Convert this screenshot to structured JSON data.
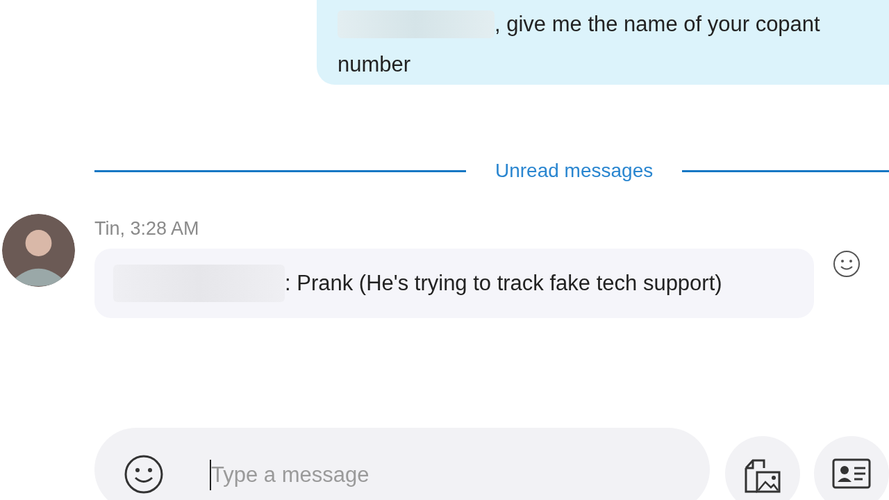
{
  "sent_message": {
    "lines": [
      ", give me the name of your copant",
      "number"
    ]
  },
  "divider": {
    "label": "Unread messages"
  },
  "received_message": {
    "sender_time": "Tin, 3:28 AM",
    "text": ": Prank (He's trying to track fake tech support)"
  },
  "composer": {
    "placeholder": "Type a message"
  }
}
